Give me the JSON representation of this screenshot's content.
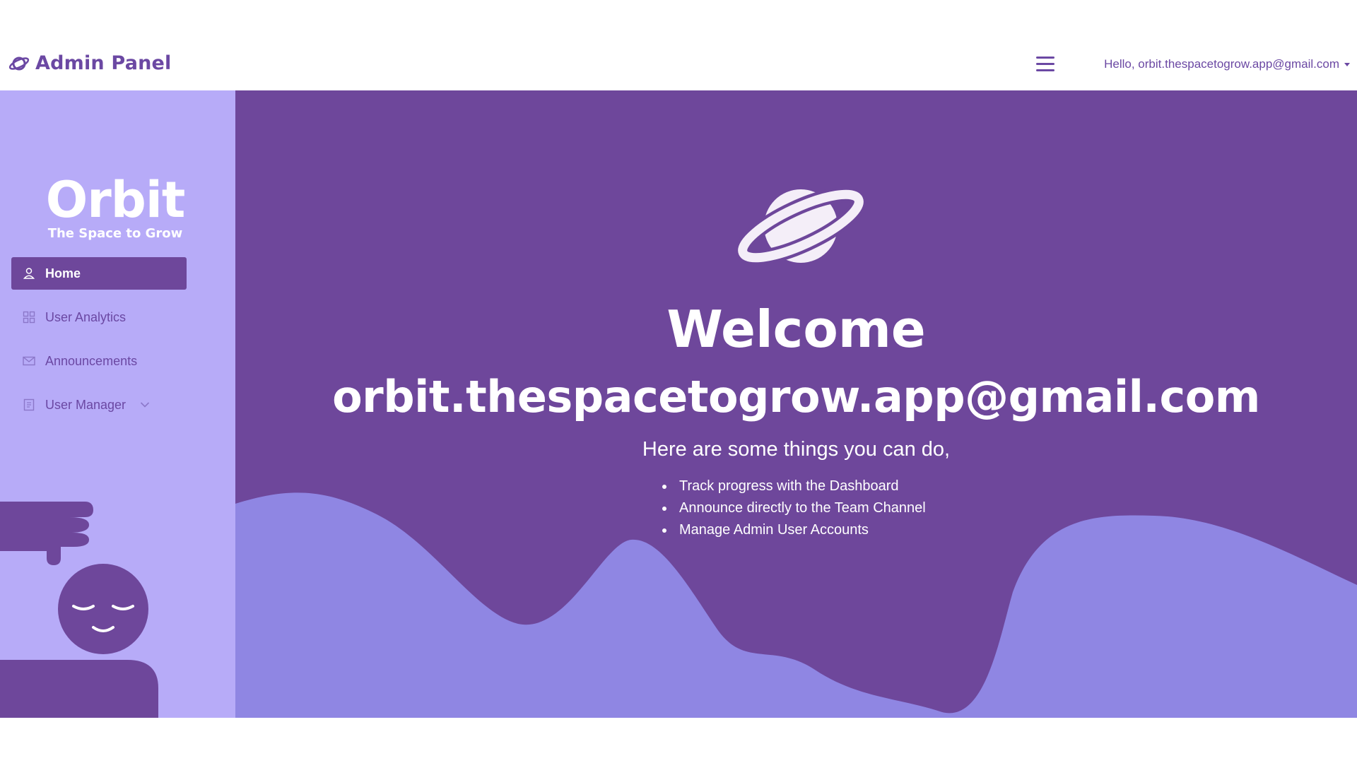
{
  "navbar": {
    "brand": "Admin Panel",
    "brand_icon": "planet-icon",
    "menu_icon": "hamburger-menu-icon",
    "user_greeting": "Hello, orbit.thespacetogrow.app@gmail.com"
  },
  "sidebar": {
    "logo_title": "Orbit",
    "logo_subtitle": "The Space to Grow",
    "items": [
      {
        "label": "Home",
        "icon": "user-icon",
        "active": true
      },
      {
        "label": "User Analytics",
        "icon": "grid-icon",
        "active": false
      },
      {
        "label": "Announcements",
        "icon": "envelope-icon",
        "active": false
      },
      {
        "label": "User Manager",
        "icon": "document-icon",
        "active": false,
        "expandable": true
      }
    ]
  },
  "main": {
    "welcome": "Welcome",
    "email": "orbit.thespacetogrow.app@gmail.com",
    "subtitle": "Here are some things you can do,",
    "things": [
      "Track progress with the Dashboard",
      "Announce directly to the Team Channel",
      "Manage Admin User Accounts"
    ]
  },
  "colors": {
    "brand_purple": "#6e479b",
    "sidebar_lavender": "#b7abf8",
    "wave_purple": "#8f86e3",
    "text_purple": "#6b48a3"
  }
}
